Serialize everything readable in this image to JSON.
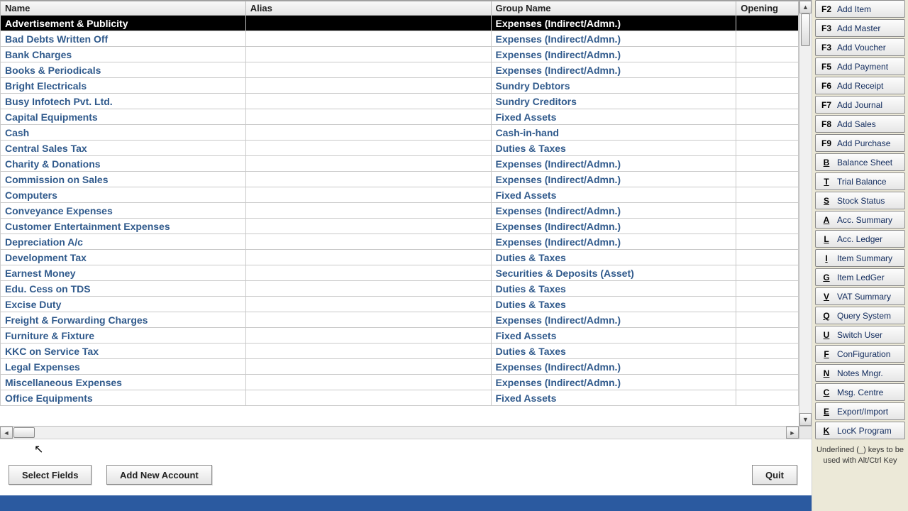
{
  "columns": {
    "name": "Name",
    "alias": "Alias",
    "group": "Group Name",
    "opening": "Opening"
  },
  "rows": [
    {
      "name": "Advertisement & Publicity",
      "alias": "",
      "group": "Expenses (Indirect/Admn.)",
      "opening": "",
      "selected": true
    },
    {
      "name": "Bad Debts Written Off",
      "alias": "",
      "group": "Expenses (Indirect/Admn.)",
      "opening": ""
    },
    {
      "name": "Bank Charges",
      "alias": "",
      "group": "Expenses (Indirect/Admn.)",
      "opening": ""
    },
    {
      "name": "Books & Periodicals",
      "alias": "",
      "group": "Expenses (Indirect/Admn.)",
      "opening": ""
    },
    {
      "name": "Bright Electricals",
      "alias": "",
      "group": "Sundry Debtors",
      "opening": ""
    },
    {
      "name": "Busy Infotech Pvt. Ltd.",
      "alias": "",
      "group": "Sundry Creditors",
      "opening": ""
    },
    {
      "name": "Capital Equipments",
      "alias": "",
      "group": "Fixed Assets",
      "opening": ""
    },
    {
      "name": "Cash",
      "alias": "",
      "group": "Cash-in-hand",
      "opening": ""
    },
    {
      "name": "Central Sales Tax",
      "alias": "",
      "group": "Duties & Taxes",
      "opening": ""
    },
    {
      "name": "Charity & Donations",
      "alias": "",
      "group": "Expenses (Indirect/Admn.)",
      "opening": ""
    },
    {
      "name": "Commission on Sales",
      "alias": "",
      "group": "Expenses (Indirect/Admn.)",
      "opening": ""
    },
    {
      "name": "Computers",
      "alias": "",
      "group": "Fixed Assets",
      "opening": ""
    },
    {
      "name": "Conveyance Expenses",
      "alias": "",
      "group": "Expenses (Indirect/Admn.)",
      "opening": ""
    },
    {
      "name": "Customer Entertainment Expenses",
      "alias": "",
      "group": "Expenses (Indirect/Admn.)",
      "opening": ""
    },
    {
      "name": "Depreciation A/c",
      "alias": "",
      "group": "Expenses (Indirect/Admn.)",
      "opening": ""
    },
    {
      "name": "Development Tax",
      "alias": "",
      "group": "Duties & Taxes",
      "opening": ""
    },
    {
      "name": "Earnest Money",
      "alias": "",
      "group": "Securities & Deposits (Asset)",
      "opening": ""
    },
    {
      "name": "Edu. Cess on TDS",
      "alias": "",
      "group": "Duties & Taxes",
      "opening": ""
    },
    {
      "name": "Excise Duty",
      "alias": "",
      "group": "Duties & Taxes",
      "opening": ""
    },
    {
      "name": "Freight & Forwarding Charges",
      "alias": "",
      "group": "Expenses (Indirect/Admn.)",
      "opening": ""
    },
    {
      "name": "Furniture & Fixture",
      "alias": "",
      "group": "Fixed Assets",
      "opening": ""
    },
    {
      "name": "KKC on Service Tax",
      "alias": "",
      "group": "Duties & Taxes",
      "opening": ""
    },
    {
      "name": "Legal Expenses",
      "alias": "",
      "group": "Expenses (Indirect/Admn.)",
      "opening": ""
    },
    {
      "name": "Miscellaneous Expenses",
      "alias": "",
      "group": "Expenses (Indirect/Admn.)",
      "opening": ""
    },
    {
      "name": "Office Equipments",
      "alias": "",
      "group": "Fixed Assets",
      "opening": ""
    }
  ],
  "buttons": {
    "select_fields": "Select Fields",
    "add_new_account": "Add New Account",
    "quit": "Quit"
  },
  "sidebar": [
    {
      "key": "F2",
      "fkey": true,
      "label": "Add Item"
    },
    {
      "key": "F3",
      "fkey": true,
      "label": "Add Master"
    },
    {
      "key": "F3",
      "fkey": true,
      "label": "Add Voucher"
    },
    {
      "key": "F5",
      "fkey": true,
      "label": "Add Payment"
    },
    {
      "key": "F6",
      "fkey": true,
      "label": "Add Receipt"
    },
    {
      "key": "F7",
      "fkey": true,
      "label": "Add Journal"
    },
    {
      "key": "F8",
      "fkey": true,
      "label": "Add Sales"
    },
    {
      "key": "F9",
      "fkey": true,
      "label": "Add Purchase"
    },
    {
      "key": "B",
      "fkey": false,
      "label": "Balance Sheet"
    },
    {
      "key": "T",
      "fkey": false,
      "label": "Trial Balance"
    },
    {
      "key": "S",
      "fkey": false,
      "label": "Stock Status"
    },
    {
      "key": "A",
      "fkey": false,
      "label": "Acc. Summary"
    },
    {
      "key": "L",
      "fkey": false,
      "label": "Acc. Ledger"
    },
    {
      "key": "I",
      "fkey": false,
      "label": "Item Summary"
    },
    {
      "key": "G",
      "fkey": false,
      "label": "Item LedGer"
    },
    {
      "key": "V",
      "fkey": false,
      "label": "VAT Summary"
    },
    {
      "key": "Q",
      "fkey": false,
      "label": "Query System"
    },
    {
      "key": "U",
      "fkey": false,
      "label": "Switch User"
    },
    {
      "key": "F",
      "fkey": false,
      "label": "ConFiguration"
    },
    {
      "key": "N",
      "fkey": false,
      "label": "Notes Mngr."
    },
    {
      "key": "C",
      "fkey": false,
      "label": "Msg. Centre"
    },
    {
      "key": "E",
      "fkey": false,
      "label": "Export/Import"
    },
    {
      "key": "K",
      "fkey": false,
      "label": "LocK Program"
    }
  ],
  "sidebar_note": "Underlined (_) keys to be used with Alt/Ctrl Key"
}
